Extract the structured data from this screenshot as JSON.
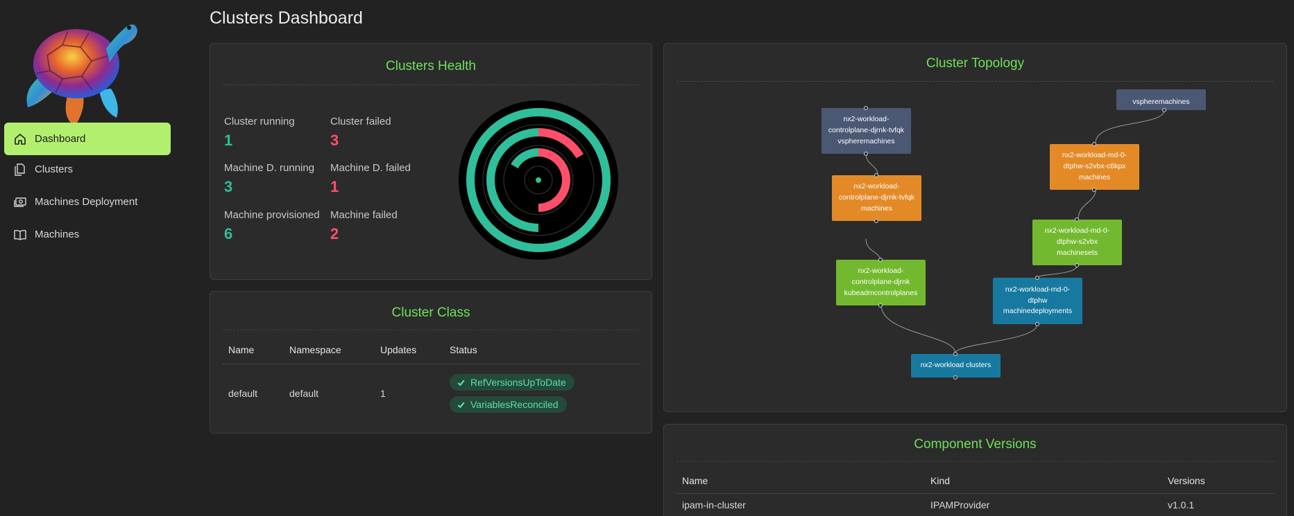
{
  "page": {
    "title": "Clusters Dashboard"
  },
  "sidebar": {
    "items": [
      {
        "label": "Dashboard",
        "icon": "home-icon",
        "active": true
      },
      {
        "label": "Clusters",
        "icon": "files-icon",
        "active": false
      },
      {
        "label": "Machines Deployment",
        "icon": "cash-icon",
        "active": false
      },
      {
        "label": "Machines",
        "icon": "book-icon",
        "active": false
      }
    ]
  },
  "health": {
    "title": "Clusters Health",
    "stats": [
      {
        "label": "Cluster running",
        "value": "1",
        "status": "ok"
      },
      {
        "label": "Cluster failed",
        "value": "3",
        "status": "fail"
      },
      {
        "label": "Machine D. running",
        "value": "3",
        "status": "ok"
      },
      {
        "label": "Machine D. failed",
        "value": "1",
        "status": "fail"
      },
      {
        "label": "Machine provisioned",
        "value": "6",
        "status": "ok"
      },
      {
        "label": "Machine failed",
        "value": "2",
        "status": "fail"
      }
    ],
    "colors": {
      "ok": "#2fbf9a",
      "fail": "#ff4f6b",
      "track": "#000000"
    }
  },
  "cluster_class": {
    "title": "Cluster Class",
    "columns": [
      "Name",
      "Namespace",
      "Updates",
      "Status"
    ],
    "rows": [
      {
        "name": "default",
        "namespace": "default",
        "updates": "1",
        "status": [
          "RefVersionsUpToDate",
          "VariablesReconciled"
        ]
      }
    ]
  },
  "topology": {
    "title": "Cluster Topology",
    "nodes": [
      {
        "id": "vsm-top",
        "label": "vspheremachines",
        "color": "slate"
      },
      {
        "id": "cp-vsm",
        "label": "nx2-workload-controlplane-djrnk-tvfqk vspheremachines",
        "color": "slate"
      },
      {
        "id": "md-machines",
        "label": "nx2-workload-md-0-dtphw-s2vbx-c6kpx machines",
        "color": "orange"
      },
      {
        "id": "cp-machines",
        "label": "nx2-workload-controlplane-djrnk-tvfqk machines",
        "color": "orange"
      },
      {
        "id": "md-ms",
        "label": "nx2-workload-md-0-dtphw-s2vbx machinesets",
        "color": "lime"
      },
      {
        "id": "cp-kcp",
        "label": "nx2-workload-controlplane-djrnk kubeadmcontrolplanes",
        "color": "lime"
      },
      {
        "id": "md-md",
        "label": "nx2-workload-md-0-dtphw machinedeployments",
        "color": "blue"
      },
      {
        "id": "clusters",
        "label": "nx2-workload clusters",
        "color": "blue"
      }
    ]
  },
  "components": {
    "title": "Component Versions",
    "columns": [
      "Name",
      "Kind",
      "Versions"
    ],
    "rows": [
      {
        "name": "ipam-in-cluster",
        "kind": "IPAMProvider",
        "version": "v1.0.1"
      }
    ]
  }
}
